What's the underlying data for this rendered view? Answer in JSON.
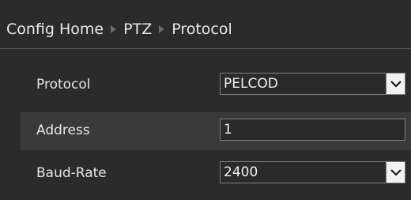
{
  "breadcrumb": {
    "items": [
      "Config Home",
      "PTZ",
      "Protocol"
    ]
  },
  "form": {
    "protocol": {
      "label": "Protocol",
      "value": "PELCOD"
    },
    "address": {
      "label": "Address",
      "value": "1"
    },
    "baud_rate": {
      "label": "Baud-Rate",
      "value": "2400"
    }
  },
  "icons": {
    "breadcrumb_separator": "chevron-right-icon",
    "dropdown": "chevron-down-icon"
  },
  "colors": {
    "background": "#2b2b2b",
    "alt_row": "#3a3a3a",
    "text": "#e6e6e6",
    "field_border": "#7f7f7f",
    "dropdown_button": "#f2f2f2"
  }
}
